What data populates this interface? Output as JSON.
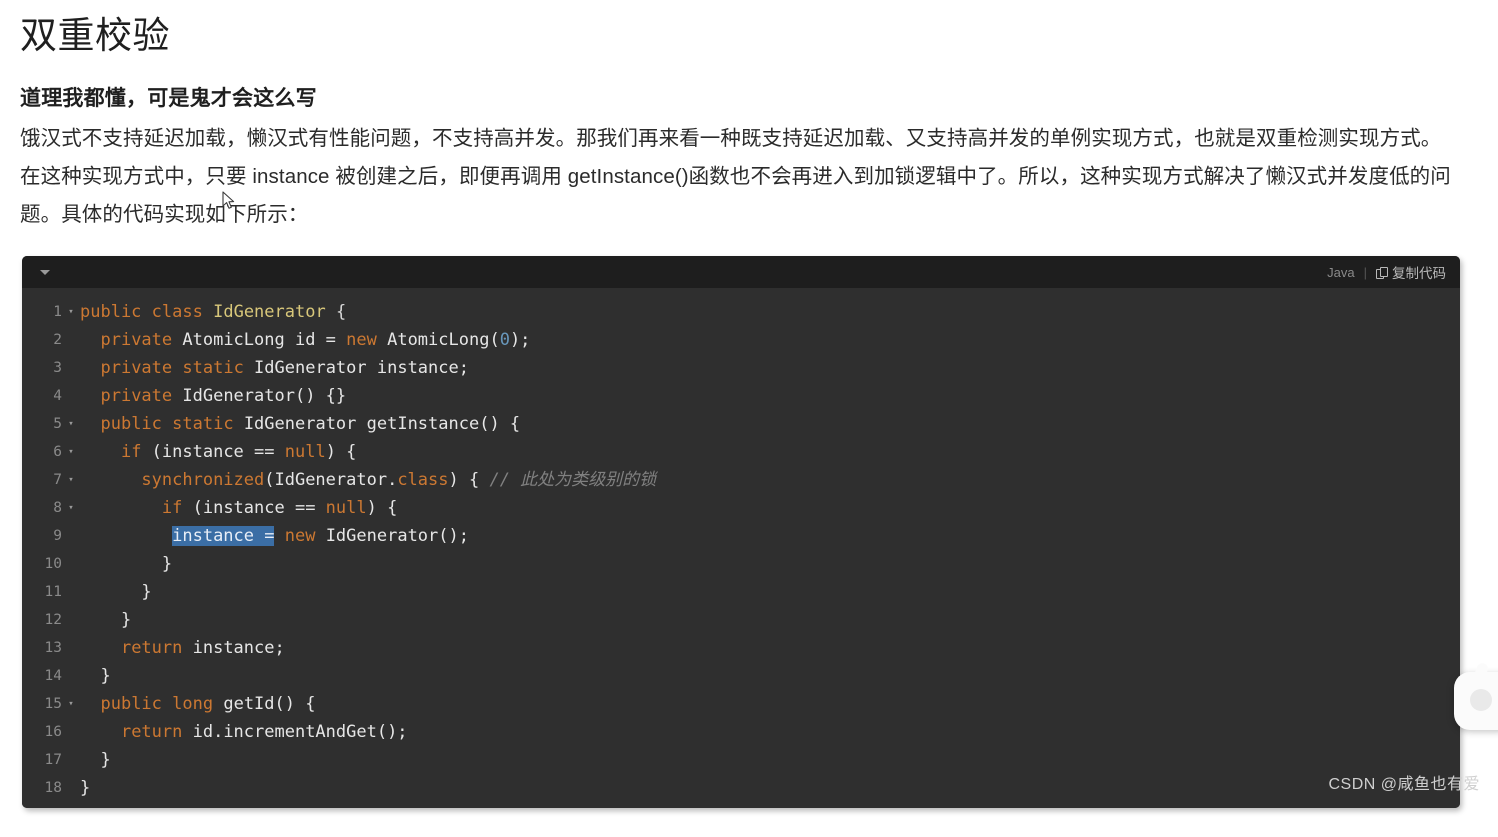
{
  "page": {
    "title": "双重校验",
    "section_title": "道理我都懂，可是鬼才会这么写",
    "paragraph_1": "饿汉式不支持延迟加载，懒汉式有性能问题，不支持高并发。那我们再来看一种既支持延迟加载、又支持高并发的单例实现方式，也就是双重检测实现方式。",
    "paragraph_2": "在这种实现方式中，只要 instance 被创建之后，即便再调用 getInstance()函数也不会再进入到加锁逻辑中了。所以，这种实现方式解决了懒汉式并发度低的问题。具体的代码实现如下所示："
  },
  "code_block": {
    "language_label": "Java",
    "separator": "|",
    "copy_label": "复制代码",
    "copy_icon": "copy-icon",
    "collapse_icon": "caret-down-icon",
    "fold_marker": "▾",
    "lines": [
      {
        "n": "1",
        "fold": true,
        "tokens": [
          {
            "t": "kw",
            "v": "public"
          },
          {
            "t": "id",
            "v": " "
          },
          {
            "t": "kw",
            "v": "class"
          },
          {
            "t": "id",
            "v": " "
          },
          {
            "t": "type",
            "v": "IdGenerator"
          },
          {
            "t": "punc",
            "v": " {"
          }
        ]
      },
      {
        "n": "2",
        "fold": false,
        "tokens": [
          {
            "t": "id",
            "v": "  "
          },
          {
            "t": "kw",
            "v": "private"
          },
          {
            "t": "id",
            "v": " AtomicLong id = "
          },
          {
            "t": "kw",
            "v": "new"
          },
          {
            "t": "id",
            "v": " AtomicLong("
          },
          {
            "t": "num",
            "v": "0"
          },
          {
            "t": "id",
            "v": ");"
          }
        ]
      },
      {
        "n": "3",
        "fold": false,
        "tokens": [
          {
            "t": "id",
            "v": "  "
          },
          {
            "t": "kw",
            "v": "private"
          },
          {
            "t": "id",
            "v": " "
          },
          {
            "t": "kw",
            "v": "static"
          },
          {
            "t": "id",
            "v": " IdGenerator instance;"
          }
        ]
      },
      {
        "n": "4",
        "fold": false,
        "tokens": [
          {
            "t": "id",
            "v": "  "
          },
          {
            "t": "kw",
            "v": "private"
          },
          {
            "t": "id",
            "v": " IdGenerator() {}"
          }
        ]
      },
      {
        "n": "5",
        "fold": true,
        "tokens": [
          {
            "t": "id",
            "v": "  "
          },
          {
            "t": "kw",
            "v": "public"
          },
          {
            "t": "id",
            "v": " "
          },
          {
            "t": "kw",
            "v": "static"
          },
          {
            "t": "id",
            "v": " IdGenerator getInstance() {"
          }
        ]
      },
      {
        "n": "6",
        "fold": true,
        "tokens": [
          {
            "t": "id",
            "v": "    "
          },
          {
            "t": "kw",
            "v": "if"
          },
          {
            "t": "id",
            "v": " (instance == "
          },
          {
            "t": "kw",
            "v": "null"
          },
          {
            "t": "id",
            "v": ") {"
          }
        ]
      },
      {
        "n": "7",
        "fold": true,
        "tokens": [
          {
            "t": "id",
            "v": "      "
          },
          {
            "t": "kw",
            "v": "synchronized"
          },
          {
            "t": "id",
            "v": "(IdGenerator."
          },
          {
            "t": "kw",
            "v": "class"
          },
          {
            "t": "id",
            "v": ") { "
          },
          {
            "t": "cmt",
            "v": "// 此处为类级别的锁"
          }
        ]
      },
      {
        "n": "8",
        "fold": true,
        "tokens": [
          {
            "t": "id",
            "v": "        "
          },
          {
            "t": "kw",
            "v": "if"
          },
          {
            "t": "id",
            "v": " (instance == "
          },
          {
            "t": "kw",
            "v": "null"
          },
          {
            "t": "id",
            "v": ") {"
          }
        ]
      },
      {
        "n": "9",
        "fold": false,
        "tokens": [
          {
            "t": "id",
            "v": "         "
          },
          {
            "t": "sel",
            "v": "instance ="
          },
          {
            "t": "id",
            "v": " "
          },
          {
            "t": "kw",
            "v": "new"
          },
          {
            "t": "id",
            "v": " IdGenerator();"
          }
        ]
      },
      {
        "n": "10",
        "fold": false,
        "tokens": [
          {
            "t": "id",
            "v": "        }"
          }
        ]
      },
      {
        "n": "11",
        "fold": false,
        "tokens": [
          {
            "t": "id",
            "v": "      }"
          }
        ]
      },
      {
        "n": "12",
        "fold": false,
        "tokens": [
          {
            "t": "id",
            "v": "    }"
          }
        ]
      },
      {
        "n": "13",
        "fold": false,
        "tokens": [
          {
            "t": "id",
            "v": "    "
          },
          {
            "t": "kw",
            "v": "return"
          },
          {
            "t": "id",
            "v": " instance;"
          }
        ]
      },
      {
        "n": "14",
        "fold": false,
        "tokens": [
          {
            "t": "id",
            "v": "  }"
          }
        ]
      },
      {
        "n": "15",
        "fold": true,
        "tokens": [
          {
            "t": "id",
            "v": "  "
          },
          {
            "t": "kw",
            "v": "public"
          },
          {
            "t": "id",
            "v": " "
          },
          {
            "t": "kw",
            "v": "long"
          },
          {
            "t": "id",
            "v": " getId() {"
          }
        ]
      },
      {
        "n": "16",
        "fold": false,
        "tokens": [
          {
            "t": "id",
            "v": "    "
          },
          {
            "t": "kw",
            "v": "return"
          },
          {
            "t": "id",
            "v": " id.incrementAndGet();"
          }
        ]
      },
      {
        "n": "17",
        "fold": false,
        "tokens": [
          {
            "t": "id",
            "v": "  }"
          }
        ]
      },
      {
        "n": "18",
        "fold": false,
        "tokens": [
          {
            "t": "id",
            "v": "}"
          }
        ]
      }
    ]
  },
  "watermark": "CSDN @咸鱼也有爱",
  "colors": {
    "page_background": "#ffffff",
    "code_background": "#2f2f2f",
    "toolbar_background": "#1e1e1e",
    "keyword": "#cc7832",
    "type_name": "#d8c77a",
    "number": "#6897bb",
    "comment": "#808080",
    "selection": "#3b6ea5",
    "text": "#2b2b2b"
  }
}
